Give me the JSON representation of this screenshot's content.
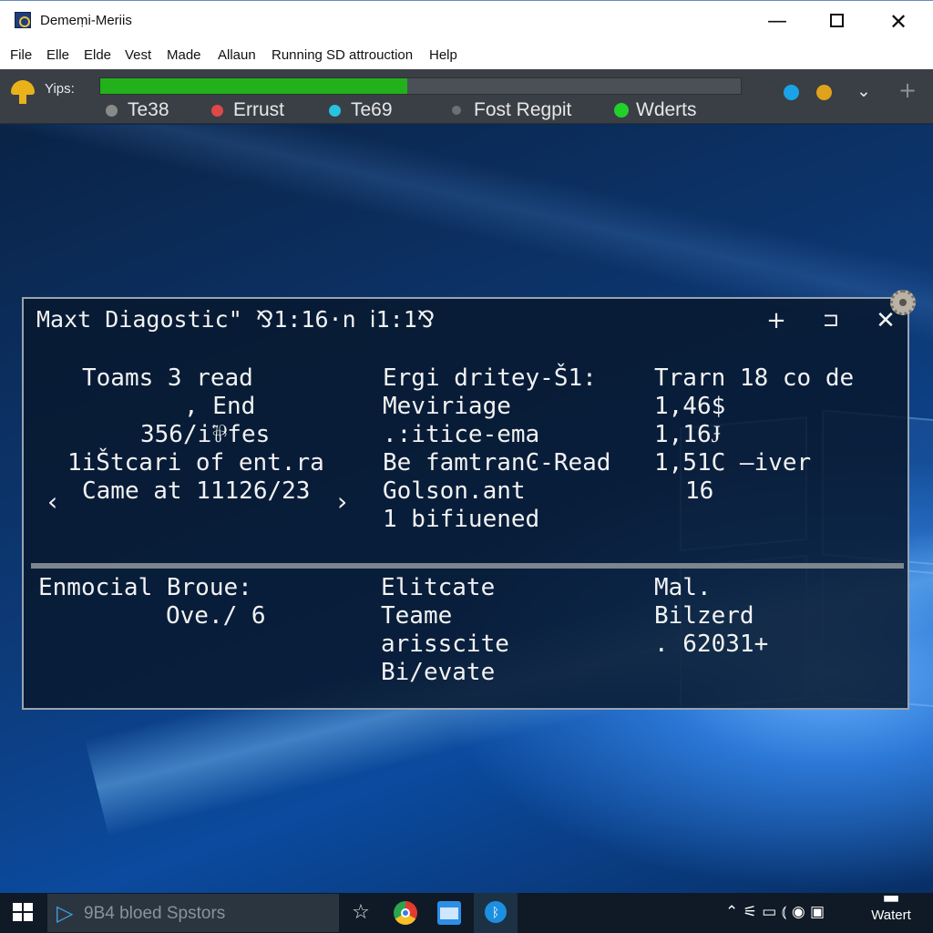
{
  "window": {
    "title": "Demeṃi-Meriis",
    "minimize_glyph": "—",
    "close_glyph": "✕"
  },
  "menu": [
    "File",
    "Elle",
    "Elde",
    "Vest",
    "Made",
    "Allaun",
    "Running SD attrouction",
    "Help"
  ],
  "toolbar": {
    "tips_label": "Yips:",
    "progress": 0.48,
    "progress_color": "#22b11b",
    "status": [
      {
        "label": "Te38",
        "color": "#8a8a8a"
      },
      {
        "label": "Errust",
        "color": "#e04848"
      },
      {
        "label": "Te69",
        "color": "#27c3e0"
      },
      {
        "label": "Fost Regpit",
        "color": "#6d6f72"
      },
      {
        "label": "Wderts",
        "color": "#22d02a"
      }
    ],
    "chevron_glyph": "⌄",
    "plus_glyph": "+"
  },
  "dialog": {
    "title": "Maxt Diagostic\" ⅋1:16·n ⅰ1:1⅋",
    "plus_glyph": "+",
    "restore_glyph": "⊐",
    "close_glyph": "✕",
    "prev_glyph": "‹",
    "next_glyph": "›",
    "col1": [
      "Toams 3 read",
      ", End",
      "356/i⅌fes",
      "1iŠtcari of ent.ra",
      "Came at 11126/23"
    ],
    "col2": [
      "Ergi dritey-Š1:",
      "Meviriage",
      ".:itice-ema",
      "Be famtranϾ-Read",
      "Golson.ant",
      "1 bifiuened"
    ],
    "col3": [
      "Trarn 18 co de",
      "1,46$",
      "1,16Ɉ",
      "1,51Ϲ —iver",
      "16"
    ],
    "section2": {
      "col1": [
        "Enmocial Broue:",
        "Ove./ 6"
      ],
      "col2": [
        "Elitcate",
        "Teame",
        "arisscite",
        "Bi/evate"
      ],
      "col3": [
        "Mal.",
        "Bilzerd",
        ".   62031+"
      ]
    }
  },
  "taskbar": {
    "search_text": "9Β4 bloed Spstors",
    "clock": "Watert",
    "tray_glyphs": "⌃ ⚟ ▭ ⦅ ◉ ▣"
  }
}
